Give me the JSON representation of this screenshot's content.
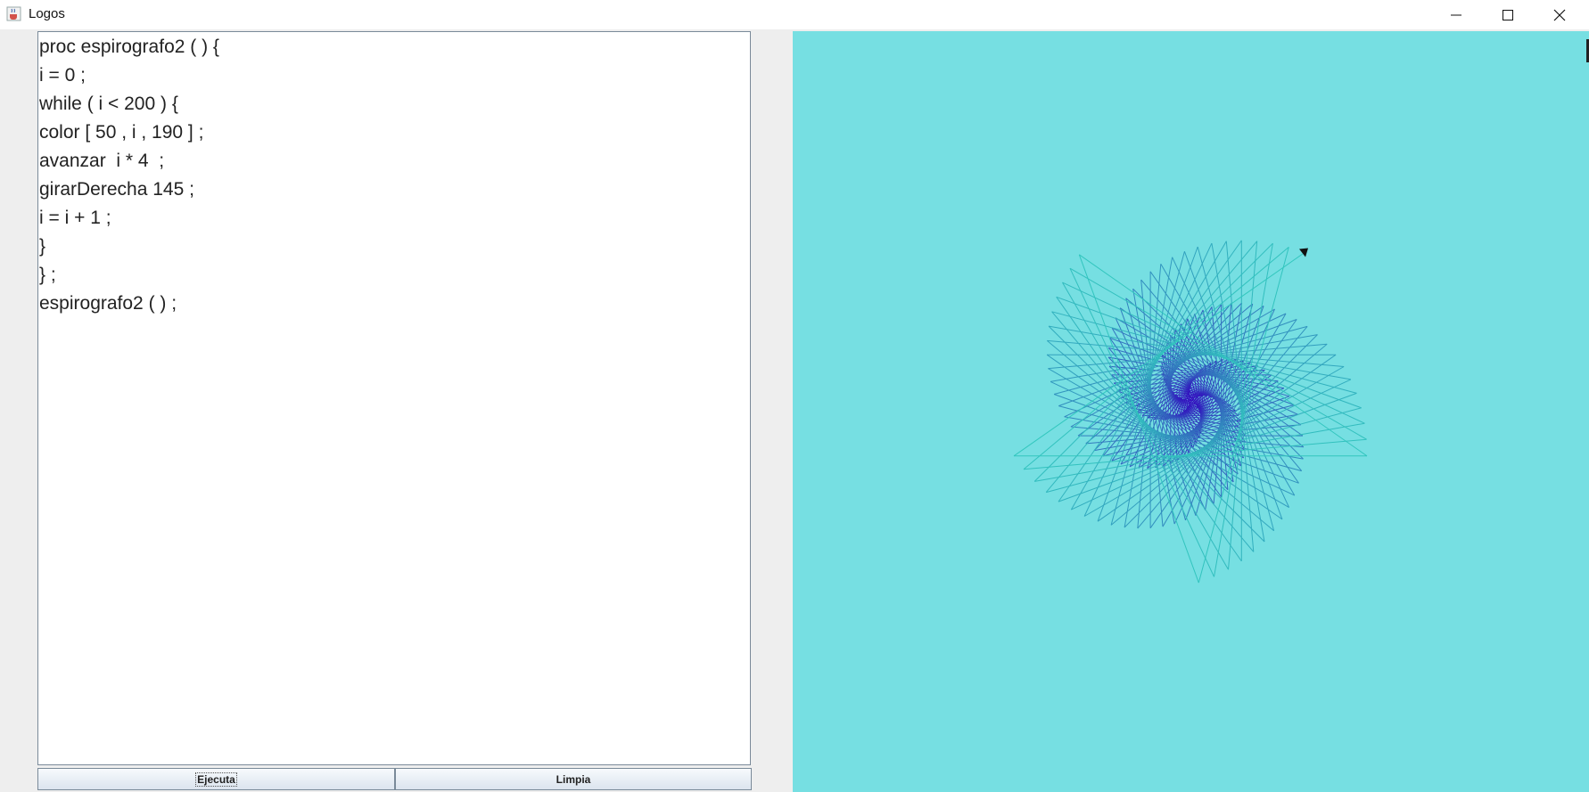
{
  "window": {
    "title": "Logos",
    "app_icon": "java-cup-icon",
    "controls": [
      "minimize-icon",
      "maximize-icon",
      "close-icon"
    ]
  },
  "editor": {
    "lines": [
      "proc espirografo2 ( ) {",
      "i = 0 ;",
      "while ( i < 200 ) {",
      "color [ 50 , i , 190 ] ;",
      "avanzar  i * 4  ;",
      "girarDerecha 145 ;",
      "i = i + 1 ;",
      "}",
      "} ;",
      "espirografo2 ( ) ;"
    ]
  },
  "buttons": {
    "run_label": "Ejecuta",
    "clear_label": "Limpia"
  },
  "canvas": {
    "background": "#76dfe2",
    "drawing": {
      "iterations": 200,
      "step_multiplier": 4,
      "turn_right_degrees": 145,
      "color_rgb": [
        50,
        "i",
        190
      ]
    },
    "turtle_icon": "turtle-arrow-icon"
  }
}
